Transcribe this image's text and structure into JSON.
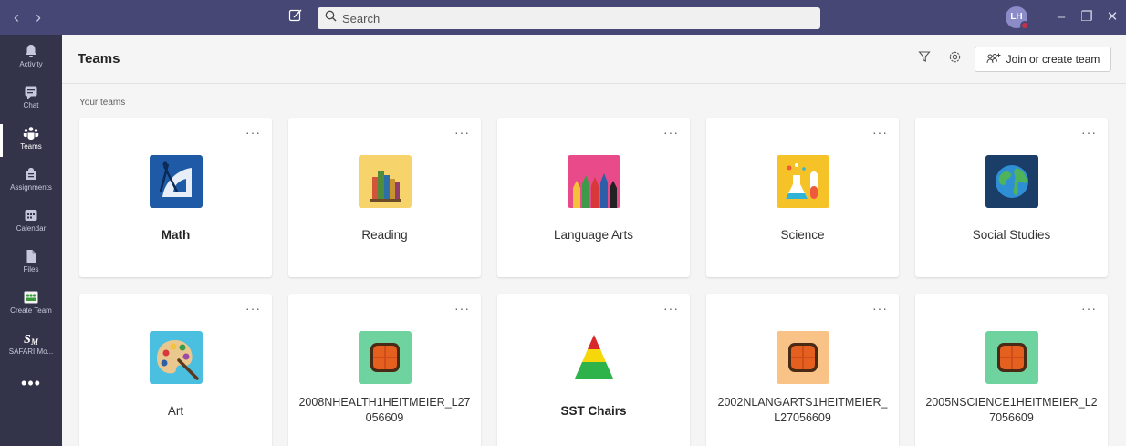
{
  "titlebar": {
    "back": "‹",
    "forward": "›",
    "search_placeholder": "Search",
    "avatar_initials": "LH",
    "minimize": "–",
    "maximize": "❐",
    "close": "✕"
  },
  "rail": {
    "items": [
      {
        "label": "Activity",
        "icon": "bell-icon"
      },
      {
        "label": "Chat",
        "icon": "chat-icon"
      },
      {
        "label": "Teams",
        "icon": "teams-icon"
      },
      {
        "label": "Assignments",
        "icon": "assignments-icon"
      },
      {
        "label": "Calendar",
        "icon": "calendar-icon"
      },
      {
        "label": "Files",
        "icon": "files-icon"
      },
      {
        "label": "Create Team",
        "icon": "create-team-icon"
      },
      {
        "label": "SAFARI Mo...",
        "icon": "safari-icon"
      }
    ],
    "more": "•••",
    "active": "Teams"
  },
  "header": {
    "title": "Teams",
    "join_label": "Join or create team"
  },
  "section_label": "Your teams",
  "teams": [
    {
      "name": "Math",
      "bold": true
    },
    {
      "name": "Reading",
      "bold": false
    },
    {
      "name": "Language Arts",
      "bold": false
    },
    {
      "name": "Science",
      "bold": false
    },
    {
      "name": "Social Studies",
      "bold": false
    },
    {
      "name": "Art",
      "bold": false
    },
    {
      "name": "2008NHEALTH1HEITMEIER_L27056609",
      "bold": false
    },
    {
      "name": "SST Chairs",
      "bold": true
    },
    {
      "name": "2002NLANGARTS1HEITMEIER_L27056609",
      "bold": false
    },
    {
      "name": "2005NSCIENCE1HEITMEIER_L27056609",
      "bold": false
    }
  ],
  "card_more": "···",
  "colors": {
    "titlebar": "#464775",
    "rail": "#33344a",
    "accent": "#6264a7"
  }
}
